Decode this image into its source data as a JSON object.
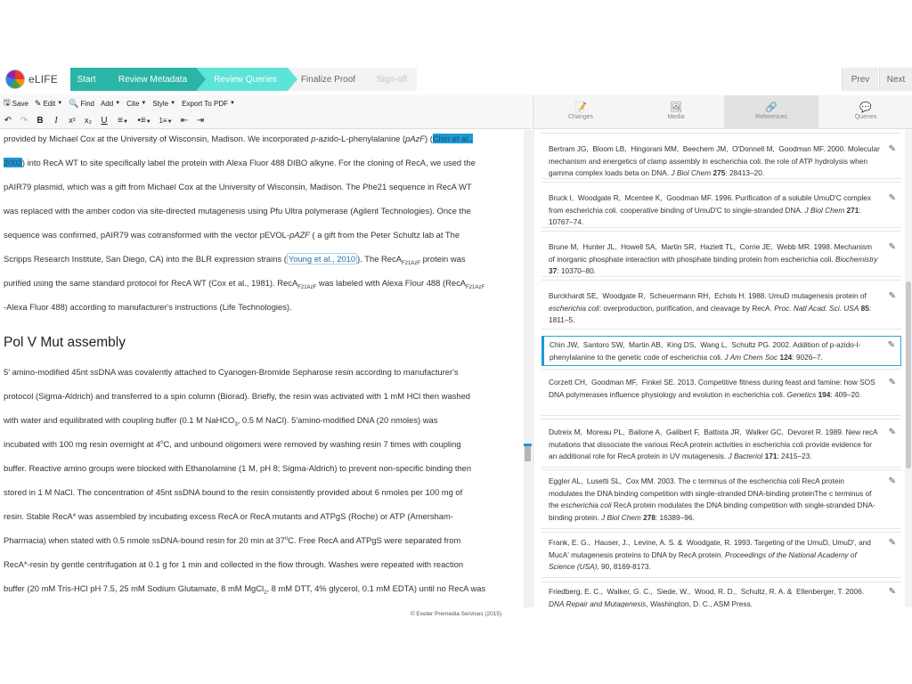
{
  "app": {
    "brand": "eLIFE"
  },
  "workflow": {
    "steps": [
      "Start",
      "Review Metadata",
      "Review Queries",
      "Finalize Proof",
      "Sign-off"
    ],
    "prev": "Prev",
    "next": "Next"
  },
  "toolbar": {
    "save": "Save",
    "edit": "Edit",
    "find": "Find",
    "add": "Add",
    "cite": "Cite",
    "style": "Style",
    "export": "Export To PDF"
  },
  "editor": {
    "heading": "Pol V Mut assembly"
  },
  "panel_tabs": [
    "Changes",
    "Media",
    "References",
    "Queries"
  ],
  "references": [
    "r0",
    "r1",
    "r2",
    "r3",
    "r4",
    "r5",
    "r6",
    "r7",
    "r8",
    "r9"
  ],
  "footer": "© Exeter Premedia Services (2015)",
  "colors": {
    "workflow_done": "#2bb5a6",
    "workflow_active": "#5de3d8",
    "highlight": "#1a9ad6"
  }
}
